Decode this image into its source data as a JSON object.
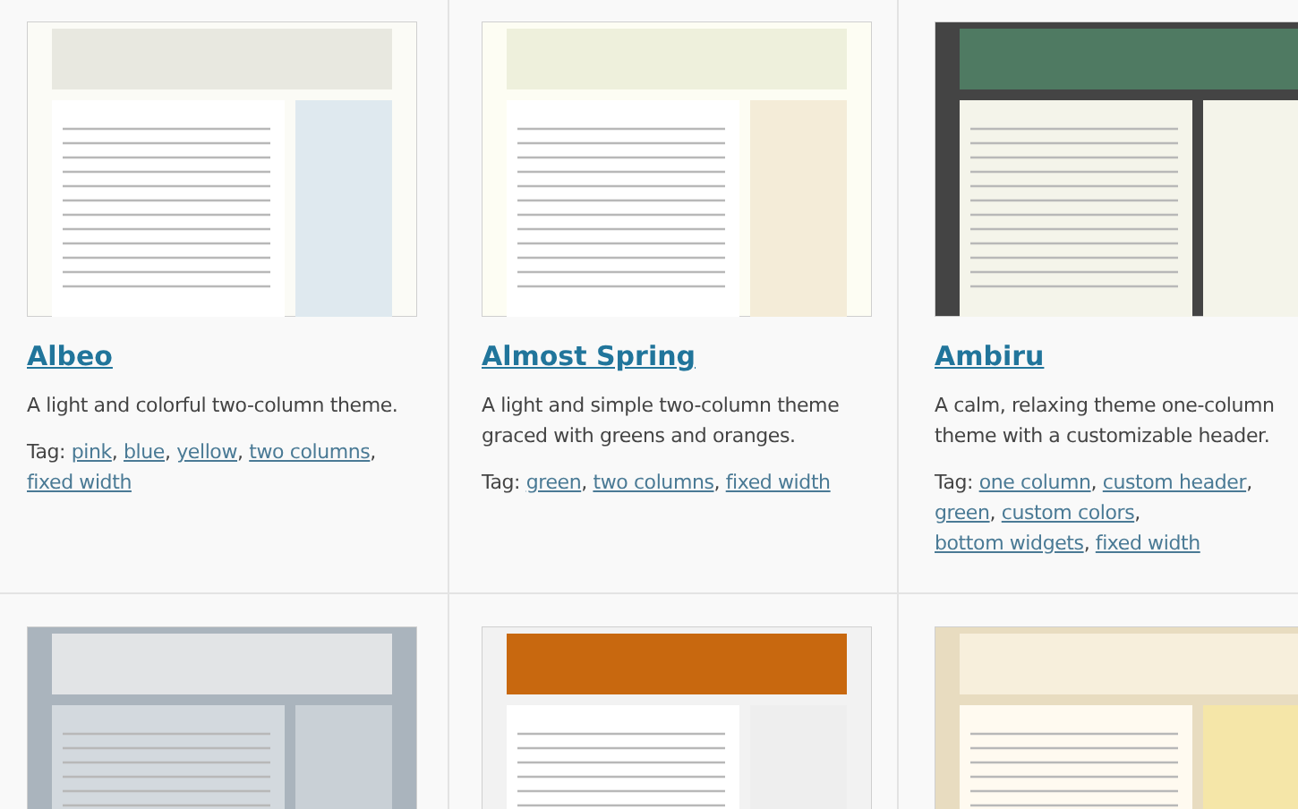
{
  "themes": [
    {
      "kind": "light",
      "name": "Albeo",
      "description": "A light and colorful two-column theme.",
      "tag_label": "Tag:",
      "tags": [
        "pink",
        "blue",
        "yellow",
        "two columns",
        "fixed width"
      ]
    },
    {
      "kind": "green",
      "name": "Almost Spring",
      "description": "A light and simple two-column theme graced with greens and oranges.",
      "tag_label": "Tag:",
      "tags": [
        "green",
        "two columns",
        "fixed width"
      ]
    },
    {
      "kind": "dark",
      "name": "Ambiru",
      "description": "A calm, relaxing theme one-column theme with a customizable header.",
      "tag_label": "Tag:",
      "tags": [
        "one column",
        "custom header",
        "green",
        "custom colors",
        "bottom widgets",
        "fixed width"
      ]
    },
    {
      "kind": "grey"
    },
    {
      "kind": "orange"
    },
    {
      "kind": "beige"
    }
  ],
  "tag_separator": ","
}
